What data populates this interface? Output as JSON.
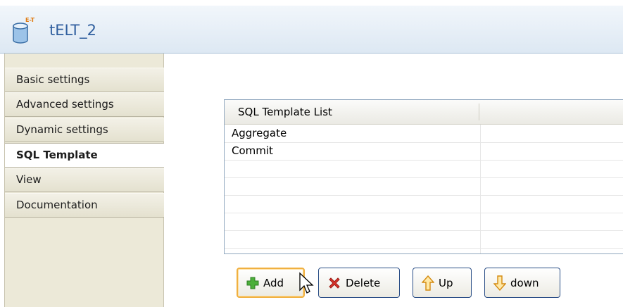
{
  "component": {
    "title": "tELT_2",
    "icon": "database-cylinder-icon",
    "icon_badge": "E-T"
  },
  "sidebar": {
    "items": [
      {
        "label": "Basic settings",
        "active": false
      },
      {
        "label": "Advanced settings",
        "active": false
      },
      {
        "label": "Dynamic settings",
        "active": false
      },
      {
        "label": "SQL Template",
        "active": true
      },
      {
        "label": "View",
        "active": false
      },
      {
        "label": "Documentation",
        "active": false
      }
    ]
  },
  "table": {
    "column_header": "SQL Template List",
    "rows": [
      "Aggregate",
      "Commit",
      "",
      "",
      "",
      "",
      ""
    ]
  },
  "buttons": {
    "add": {
      "label": "Add",
      "icon": "plus-icon"
    },
    "delete": {
      "label": "Delete",
      "icon": "red-x-icon"
    },
    "up": {
      "label": "Up",
      "icon": "arrow-up-icon"
    },
    "down": {
      "label": "down",
      "icon": "arrow-down-icon"
    }
  },
  "colors": {
    "title": "#2f5e9e",
    "sidebar": "#ece9d8",
    "button_border": "#2a4e86",
    "focus": "#f0b040"
  }
}
